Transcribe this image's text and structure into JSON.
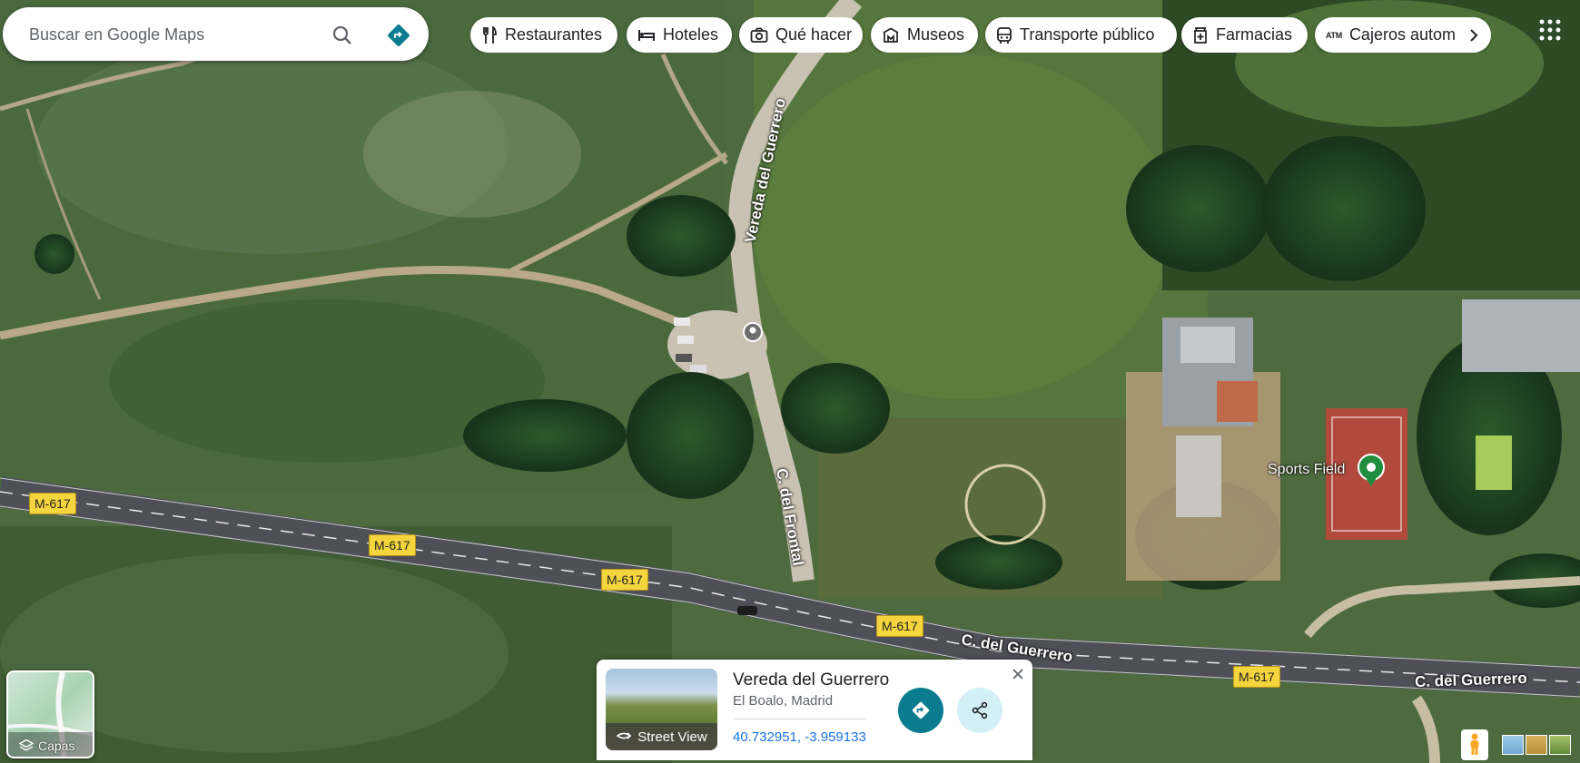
{
  "search": {
    "placeholder": "Buscar en Google Maps"
  },
  "chips": [
    {
      "label": "Restaurantes",
      "icon": "fork-knife-icon"
    },
    {
      "label": "Hoteles",
      "icon": "bed-icon"
    },
    {
      "label": "Qué hacer",
      "icon": "camera-icon"
    },
    {
      "label": "Museos",
      "icon": "museum-icon"
    },
    {
      "label": "Transporte público",
      "icon": "bus-icon"
    },
    {
      "label": "Farmacias",
      "icon": "pharmacy-icon"
    },
    {
      "label": "Cajeros autom",
      "icon": "atm-icon",
      "icon_text": "ATM"
    }
  ],
  "map": {
    "road_labels": {
      "vereda": "Vereda del Guerrero",
      "frontal": "C. del Frontal",
      "guerrero_1": "C. del Guerrero",
      "guerrero_2": "C. del Guerrero"
    },
    "shields": [
      "M-617",
      "M-617",
      "M-617",
      "M-617",
      "M-617"
    ],
    "poi": {
      "label": "Sports Field",
      "color": "#1e8e3e"
    }
  },
  "place_card": {
    "title": "Vereda del Guerrero",
    "subtitle": "El Boalo, Madrid",
    "coords": "40.732951, -3.959133",
    "street_view_label": "Street View"
  },
  "layers": {
    "label": "Capas"
  },
  "colors": {
    "accent": "#0b7c8f",
    "link": "#1a73e8"
  }
}
